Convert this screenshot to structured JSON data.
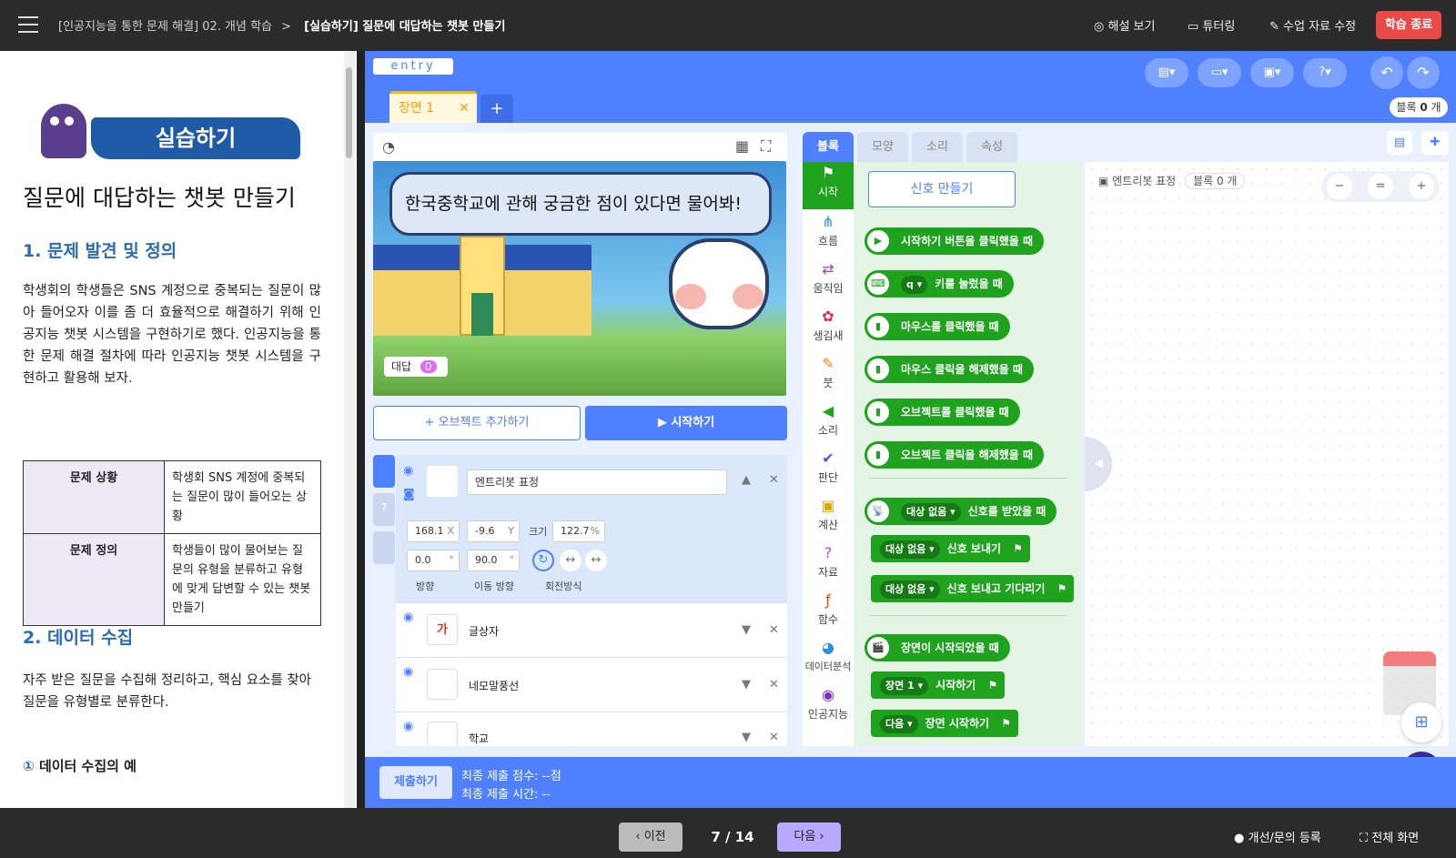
{
  "topbar": {
    "breadcrumb": "[인공지능을 통한 문제 해결] 02. 개념 학습",
    "current": "[실습하기] 질문에 대답하는 챗봇 만들기",
    "solution": "해설 보기",
    "tutoring": "튜터링",
    "edit_material": "수업 자료 수정",
    "end": "학습 종료"
  },
  "left": {
    "banner": "실습하기",
    "title": "질문에 대답하는 챗봇 만들기",
    "s1": "1. 문제 발견 및 정의",
    "p1": "학생회의 학생들은 SNS 계정으로 중복되는 질문이 많아 들어오자 이를 좀 더 효율적으로 해결하기 위해 인공지능 챗봇 시스템을 구현하기로 했다. 인공지능을 통한 문제 해결 절차에 따라 인공지능 챗봇 시스템을 구현하고 활용해 보자.",
    "table": [
      {
        "h": "문제 상황",
        "v": "학생회 SNS 계정에 중복되는 질문이 많이 들어오는 상황"
      },
      {
        "h": "문제 정의",
        "v": "학생들이 많이 물어보는 질문의 유형을 분류하고 유형에 맞게 답변할 수 있는 챗봇 만들기"
      }
    ],
    "s2": "2. 데이터 수집",
    "p2": "자주 받은 질문을 수집해 정리하고, 핵심 요소를 찾아 질문을 유형별로 분류한다.",
    "s3num": "①",
    "s3": "데이터 수집의 예"
  },
  "entry": {
    "logo": "entry",
    "scene_tab": "장면 1",
    "block_count_label": "블록",
    "block_count": "0",
    "block_count_unit": "개",
    "speech": "한국중학교에 관해 궁금한 점이 있다면 물어봐!",
    "answer_label": "대답",
    "answer_value": "0",
    "add_object": "+ 오브젝트 추가하기",
    "start": "▶ 시작하기",
    "objects": [
      {
        "name": "엔트리봇 표정"
      },
      {
        "name": "글상자"
      },
      {
        "name": "네모말풍선"
      },
      {
        "name": "학교"
      }
    ],
    "props": {
      "x": "168.1",
      "y": "-9.6",
      "size": "122.7",
      "dir": "0.0",
      "move_dir": "90.0",
      "x_label": "X",
      "y_label": "Y",
      "size_label": "크기",
      "pct": "%",
      "deg": "°",
      "dir_label": "방향",
      "move_label": "이동 방향",
      "rot_label": "회전방식"
    },
    "tabs": [
      "블록",
      "모양",
      "소리",
      "속성"
    ],
    "categories": [
      "시작",
      "흐름",
      "움직임",
      "생김새",
      "붓",
      "소리",
      "판단",
      "계산",
      "자료",
      "함수",
      "데이터분석",
      "인공지능"
    ],
    "signal_btn": "신호 만들기",
    "blocks": [
      "시작하기 버튼을 클릭했을 때",
      "키를 눌렀을 때",
      "마우스를 클릭했을 때",
      "마우스 클릭을 해제했을 때",
      "오브젝트를 클릭했을 때",
      "오브젝트 클릭을 해제했을 때",
      "신호를 받았을 때",
      "신호 보내기",
      "신호 보내고 기다리기",
      "장면이 시작되었을 때",
      "시작하기",
      "장면 시작하기"
    ],
    "dd": {
      "key": "q",
      "target": "대상 없음",
      "scene": "장면 1",
      "next": "다음"
    },
    "workspace_obj": "엔트리봇 표정",
    "workspace_count": "블록 0 개"
  },
  "submit": {
    "button": "제출하기",
    "score": "최종 제출 점수: --점",
    "time": "최종 제출 시간: --"
  },
  "footer": {
    "prev": "이전",
    "page": "7 / 14",
    "next": "다음",
    "feedback": "개선/문의 등록",
    "fullscreen": "전체 화면"
  }
}
